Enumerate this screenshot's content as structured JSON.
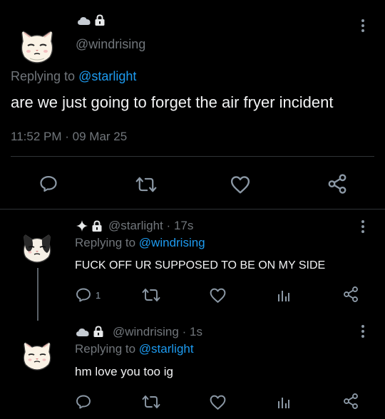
{
  "main_tweet": {
    "handle": "@windrising",
    "replying_prefix": "Replying to",
    "replying_handle": "@starlight",
    "text": "are we just going to forget the air fryer incident",
    "time": "11:52 PM",
    "dot": "·",
    "date": "09 Mar 25",
    "badges": [
      "cloud-icon",
      "lock-icon"
    ]
  },
  "replies": [
    {
      "handle": "@starlight",
      "dot": "·",
      "time": "17s",
      "replying_prefix": "Replying to",
      "replying_handle": "@windrising",
      "text": "FUCK OFF UR SUPPOSED TO BE ON MY SIDE",
      "reply_count": "1",
      "badges": [
        "sparkle-icon",
        "lock-icon"
      ]
    },
    {
      "handle": "@windrising",
      "dot": "·",
      "time": "1s",
      "replying_prefix": "Replying to",
      "replying_handle": "@starlight",
      "text": "hm love you too ig",
      "reply_count": "",
      "badges": [
        "cloud-icon",
        "lock-icon"
      ]
    }
  ],
  "colors": {
    "background": "#000000",
    "text": "#e7e9ea",
    "muted": "#71767b",
    "link": "#1d9bf0",
    "separator": "#2f3336"
  }
}
